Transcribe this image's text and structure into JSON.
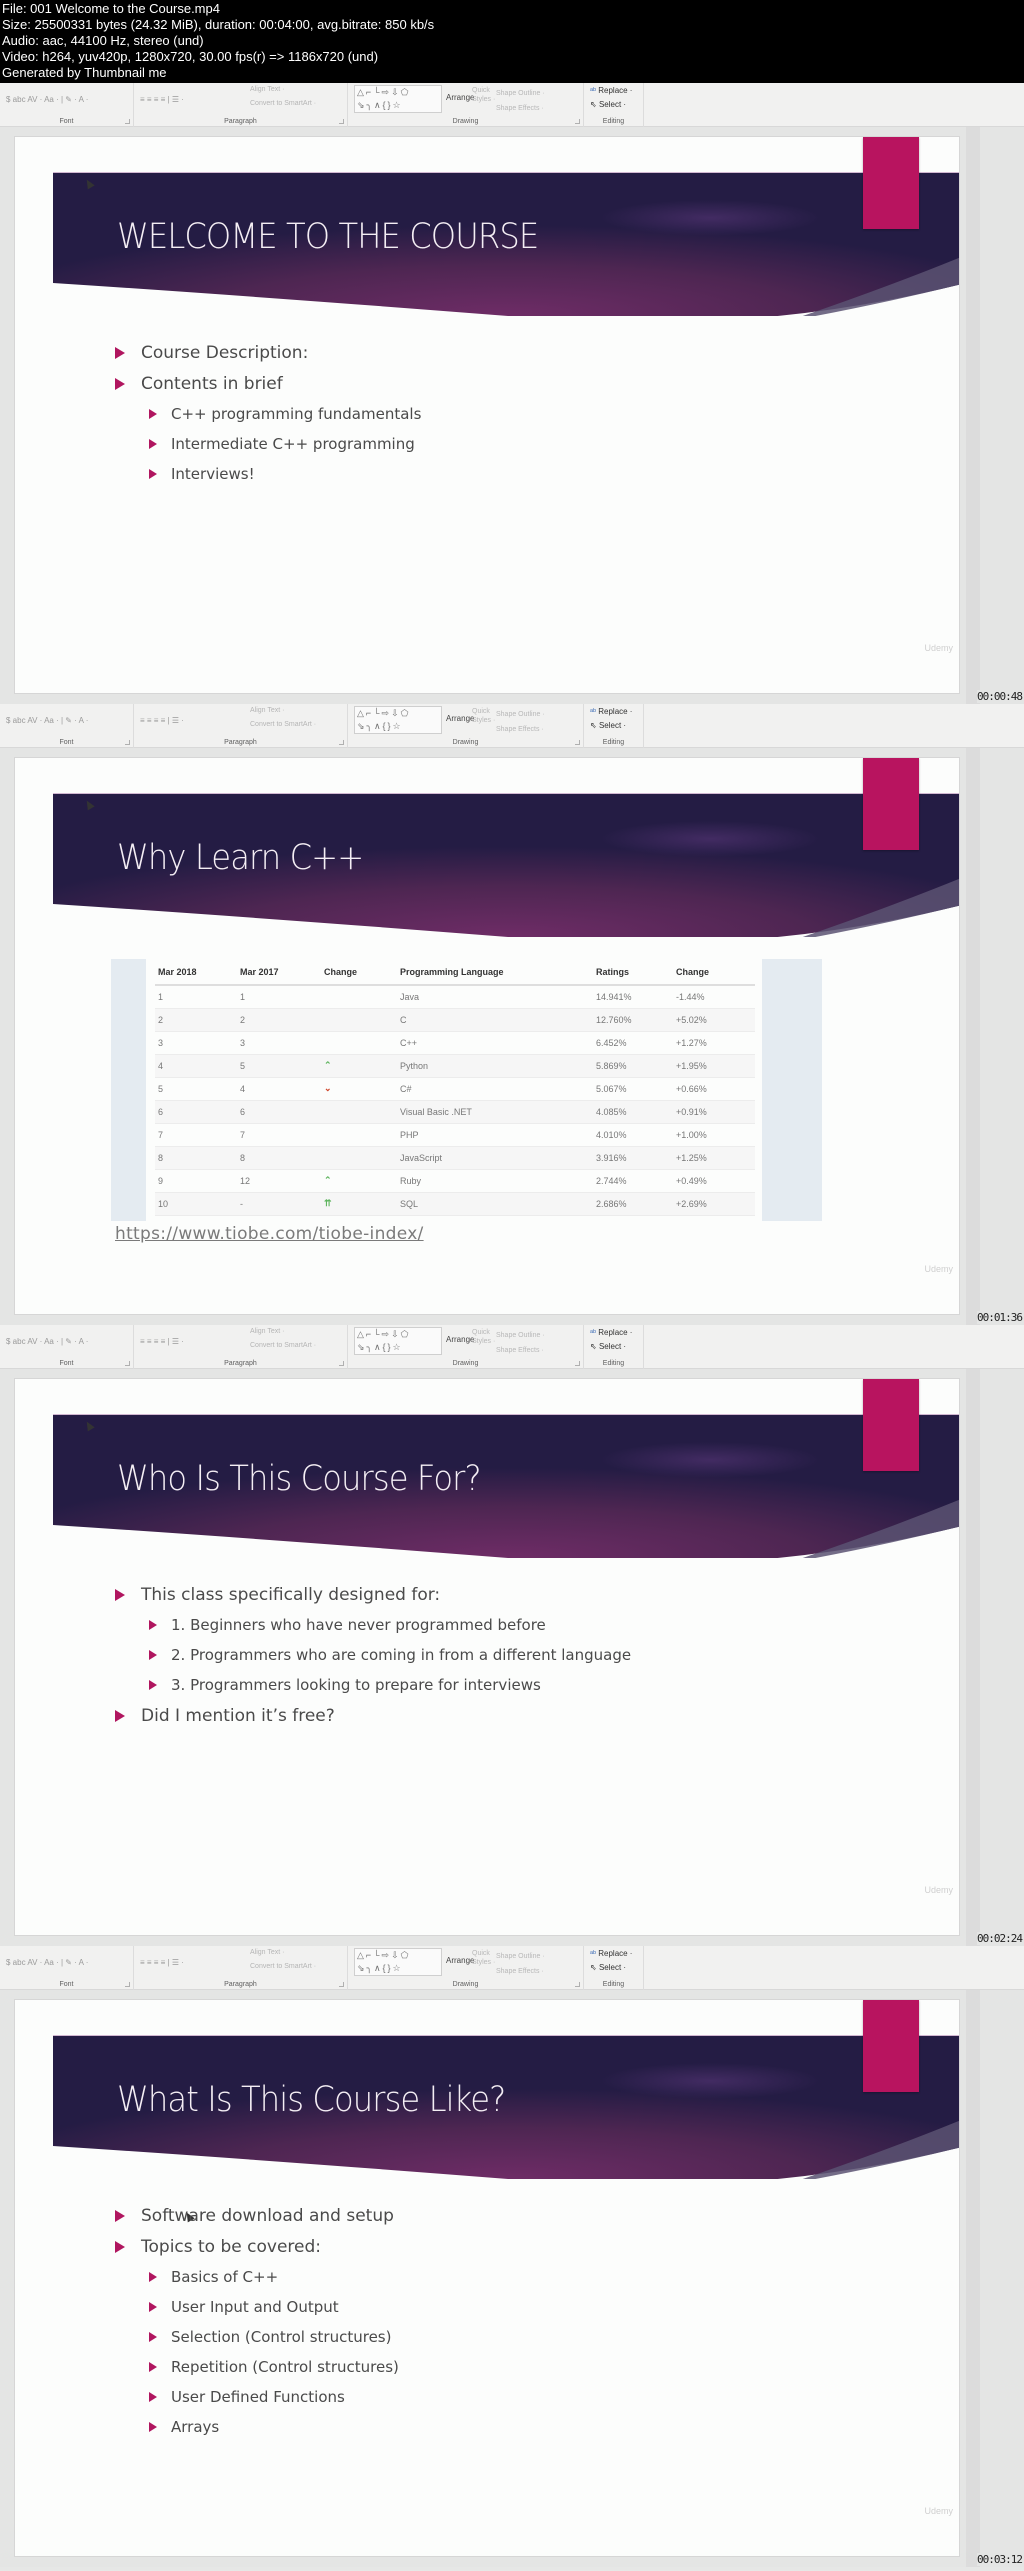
{
  "file_info": {
    "lines": [
      "File: 001 Welcome to the Course.mp4",
      "Size: 25500331 bytes (24.32 MiB), duration: 00:04:00, avg.bitrate: 850 kb/s",
      "Audio: aac, 44100 Hz, stereo (und)",
      "Video: h264, yuv420p, 1280x720, 30.00 fps(r) => 1186x720 (und)",
      "Generated by Thumbnail me"
    ]
  },
  "ribbon": {
    "font_group": "Font",
    "font_row1": "$ abc AV · Aa · | ✎ · A ·",
    "paragraph_group": "Paragraph",
    "paragraph_row1": "≡ ≡ ≡ ≡ | ☰ ·",
    "align_text": "Align Text ·",
    "convert_smartart": "Convert to SmartArt ·",
    "drawing_group": "Drawing",
    "shapes_row1": "△⌐└⇨⇩⬠",
    "shapes_row2": "⇘╮∧{}☆",
    "arrange": "Arrange",
    "quick_styles_1": "Quick",
    "quick_styles_2": "Styles ·",
    "shape_outline": "Shape Outline ·",
    "shape_effects": "Shape Effects ·",
    "editing_group": "Editing",
    "replace": "Replace ·",
    "select": "Select ·"
  },
  "colors": {
    "accent_magenta": "#b8145f",
    "banner_dark": "#261d45",
    "banner_mid": "#6a2a62",
    "bullet": "#b0165f",
    "up": "#5fb55f",
    "down": "#d0452a"
  },
  "watermark": "Udemy",
  "frames": [
    {
      "timestamp": "00:00:48",
      "title": "WELCOME TO THE COURSE",
      "bullets": [
        {
          "level": 1,
          "text": "Course Description:"
        },
        {
          "level": 1,
          "text": "Contents in brief"
        },
        {
          "level": 2,
          "text": "C++ programming fundamentals"
        },
        {
          "level": 2,
          "text": "Intermediate C++ programming"
        },
        {
          "level": 2,
          "text": "Interviews!"
        }
      ]
    },
    {
      "timestamp": "00:01:36",
      "title": "Why Learn C++",
      "table": {
        "headers": [
          "Mar 2018",
          "Mar 2017",
          "Change",
          "Programming Language",
          "Ratings",
          "Change"
        ],
        "rows": [
          {
            "mar2018": "1",
            "mar2017": "1",
            "trend": "",
            "language": "Java",
            "rating": "14.941%",
            "change": "-1.44%"
          },
          {
            "mar2018": "2",
            "mar2017": "2",
            "trend": "",
            "language": "C",
            "rating": "12.760%",
            "change": "+5.02%"
          },
          {
            "mar2018": "3",
            "mar2017": "3",
            "trend": "",
            "language": "C++",
            "rating": "6.452%",
            "change": "+1.27%"
          },
          {
            "mar2018": "4",
            "mar2017": "5",
            "trend": "up",
            "language": "Python",
            "rating": "5.869%",
            "change": "+1.95%"
          },
          {
            "mar2018": "5",
            "mar2017": "4",
            "trend": "down",
            "language": "C#",
            "rating": "5.067%",
            "change": "+0.66%"
          },
          {
            "mar2018": "6",
            "mar2017": "6",
            "trend": "",
            "language": "Visual Basic .NET",
            "rating": "4.085%",
            "change": "+0.91%"
          },
          {
            "mar2018": "7",
            "mar2017": "7",
            "trend": "",
            "language": "PHP",
            "rating": "4.010%",
            "change": "+1.00%"
          },
          {
            "mar2018": "8",
            "mar2017": "8",
            "trend": "",
            "language": "JavaScript",
            "rating": "3.916%",
            "change": "+1.25%"
          },
          {
            "mar2018": "9",
            "mar2017": "12",
            "trend": "up",
            "language": "Ruby",
            "rating": "2.744%",
            "change": "+0.49%"
          },
          {
            "mar2018": "10",
            "mar2017": "-",
            "trend": "double-up",
            "language": "SQL",
            "rating": "2.686%",
            "change": "+2.69%"
          }
        ]
      },
      "link": "https://www.tiobe.com/tiobe-index/"
    },
    {
      "timestamp": "00:02:24",
      "title": "Who Is This Course For?",
      "bullets": [
        {
          "level": 1,
          "text": "This class specifically designed for:"
        },
        {
          "level": 2,
          "text": "1. Beginners who have never programmed before"
        },
        {
          "level": 2,
          "text": "2. Programmers who are coming in from a different language"
        },
        {
          "level": 2,
          "text": "3. Programmers looking to prepare for interviews"
        },
        {
          "level": 1,
          "text": "Did I mention it’s free?"
        }
      ]
    },
    {
      "timestamp": "00:03:12",
      "title": "What Is This Course Like?",
      "bullets": [
        {
          "level": 1,
          "text": "Software download and setup"
        },
        {
          "level": 1,
          "text": "Topics to be covered:"
        },
        {
          "level": 2,
          "text": "Basics of C++"
        },
        {
          "level": 2,
          "text": "User Input and Output"
        },
        {
          "level": 2,
          "text": "Selection (Control structures)"
        },
        {
          "level": 2,
          "text": "Repetition  (Control structures)"
        },
        {
          "level": 2,
          "text": "User Defined Functions"
        },
        {
          "level": 2,
          "text": "Arrays"
        }
      ]
    }
  ]
}
